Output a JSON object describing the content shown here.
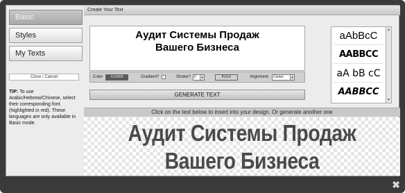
{
  "sidebar": {
    "items": [
      {
        "label": "Basic"
      },
      {
        "label": "Styles"
      },
      {
        "label": "My Texts"
      }
    ],
    "close_label": "Close / Cancel",
    "tip_label": "TIP:",
    "tip_text": "To use Arabic/Hebrew/Chinese, select their corresponding font. (highlighted in red). These languages are only available in Basic mode."
  },
  "main": {
    "title": "Create Your Text",
    "text_value_line1": "Аудит Системы Продаж",
    "text_value_line2": "Вашего Бизнеса",
    "toolbar": {
      "color_label": "Color",
      "color_value": "CC0000",
      "gradient_label": "Gradient?",
      "stroke_label": "Stroke?",
      "stroke_value": "0",
      "stroke_color": "ffc0c0",
      "alignment_label": "Alignment:",
      "alignment_value": "Center"
    },
    "generate_label": "GENERATE TEXT",
    "font_samples": [
      "aAbBcC",
      "AABBCC",
      "aA bB cC",
      "AABBCC"
    ],
    "instruction": "Click on the text below to insert into your design. Or generate another one",
    "preview_line1": "Аудит Системы Продаж",
    "preview_line2": "Вашего Бизнеса"
  },
  "colors": {
    "color_swatch": "#5a5a5a",
    "stroke_swatch": "#d0d0d0"
  },
  "window": {
    "close_icon": "✖"
  }
}
